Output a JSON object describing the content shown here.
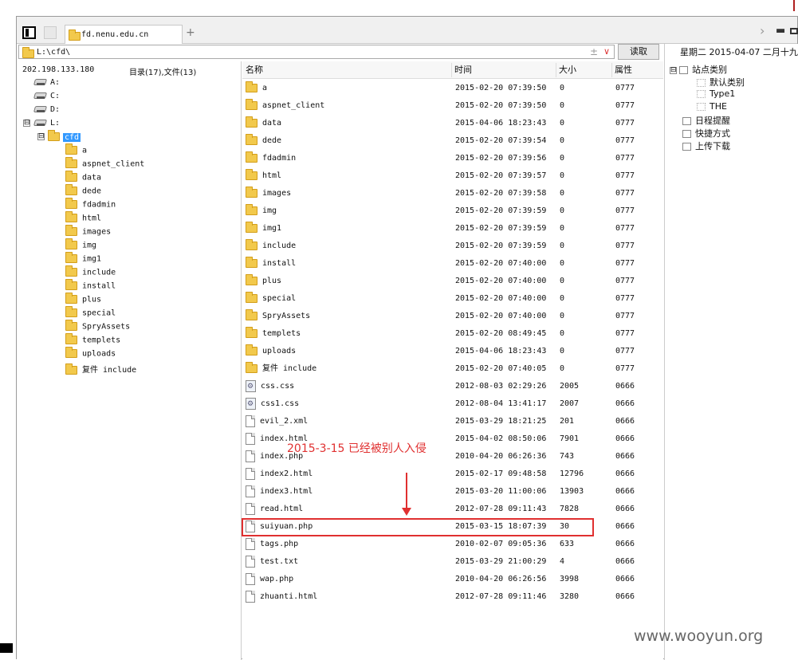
{
  "tab": {
    "title": "fd.nenu.edu.cn",
    "new_tab": "+"
  },
  "window": {
    "nav_arrow": "›",
    "minimize": "▬"
  },
  "address": {
    "path": "L:\\cfd\\",
    "plusminus": "±",
    "dropdown": "∨",
    "read_button": "读取"
  },
  "left": {
    "ip": "202.198.133.180",
    "dir_count": "目录(17),文件(13)",
    "drives": [
      {
        "label": "A:"
      },
      {
        "label": "C:"
      },
      {
        "label": "D:"
      },
      {
        "label": "L:",
        "expander": "⊟"
      }
    ],
    "cfd": {
      "label": "cfd",
      "expander": "⊟"
    },
    "folders": [
      "a",
      "aspnet_client",
      "data",
      "dede",
      "fdadmin",
      "html",
      "images",
      "img",
      "img1",
      "include",
      "install",
      "plus",
      "special",
      "SpryAssets",
      "templets",
      "uploads",
      "复件 include"
    ]
  },
  "files": {
    "columns": {
      "name": "名称",
      "time": "时间",
      "size": "大小",
      "attr": "属性"
    },
    "rows": [
      {
        "type": "folder",
        "name": "a",
        "time": "2015-02-20 07:39:50",
        "size": "0",
        "attr": "0777"
      },
      {
        "type": "folder",
        "name": "aspnet_client",
        "time": "2015-02-20 07:39:50",
        "size": "0",
        "attr": "0777"
      },
      {
        "type": "folder",
        "name": "data",
        "time": "2015-04-06 18:23:43",
        "size": "0",
        "attr": "0777"
      },
      {
        "type": "folder",
        "name": "dede",
        "time": "2015-02-20 07:39:54",
        "size": "0",
        "attr": "0777"
      },
      {
        "type": "folder",
        "name": "fdadmin",
        "time": "2015-02-20 07:39:56",
        "size": "0",
        "attr": "0777"
      },
      {
        "type": "folder",
        "name": "html",
        "time": "2015-02-20 07:39:57",
        "size": "0",
        "attr": "0777"
      },
      {
        "type": "folder",
        "name": "images",
        "time": "2015-02-20 07:39:58",
        "size": "0",
        "attr": "0777"
      },
      {
        "type": "folder",
        "name": "img",
        "time": "2015-02-20 07:39:59",
        "size": "0",
        "attr": "0777"
      },
      {
        "type": "folder",
        "name": "img1",
        "time": "2015-02-20 07:39:59",
        "size": "0",
        "attr": "0777"
      },
      {
        "type": "folder",
        "name": "include",
        "time": "2015-02-20 07:39:59",
        "size": "0",
        "attr": "0777"
      },
      {
        "type": "folder",
        "name": "install",
        "time": "2015-02-20 07:40:00",
        "size": "0",
        "attr": "0777"
      },
      {
        "type": "folder",
        "name": "plus",
        "time": "2015-02-20 07:40:00",
        "size": "0",
        "attr": "0777"
      },
      {
        "type": "folder",
        "name": "special",
        "time": "2015-02-20 07:40:00",
        "size": "0",
        "attr": "0777"
      },
      {
        "type": "folder",
        "name": "SpryAssets",
        "time": "2015-02-20 07:40:00",
        "size": "0",
        "attr": "0777"
      },
      {
        "type": "folder",
        "name": "templets",
        "time": "2015-02-20 08:49:45",
        "size": "0",
        "attr": "0777"
      },
      {
        "type": "folder",
        "name": "uploads",
        "time": "2015-04-06 18:23:43",
        "size": "0",
        "attr": "0777"
      },
      {
        "type": "folder",
        "name": "复件 include",
        "time": "2015-02-20 07:40:05",
        "size": "0",
        "attr": "0777"
      },
      {
        "type": "css",
        "name": "css.css",
        "time": "2012-08-03 02:29:26",
        "size": "2005",
        "attr": "0666"
      },
      {
        "type": "css",
        "name": "css1.css",
        "time": "2012-08-04 13:41:17",
        "size": "2007",
        "attr": "0666"
      },
      {
        "type": "file",
        "name": "evil_2.xml",
        "time": "2015-03-29 18:21:25",
        "size": "201",
        "attr": "0666"
      },
      {
        "type": "file",
        "name": "index.html",
        "time": "2015-04-02 08:50:06",
        "size": "7901",
        "attr": "0666"
      },
      {
        "type": "file",
        "name": "index.php",
        "time": "2010-04-20 06:26:36",
        "size": "743",
        "attr": "0666"
      },
      {
        "type": "file",
        "name": "index2.html",
        "time": "2015-02-17 09:48:58",
        "size": "12796",
        "attr": "0666"
      },
      {
        "type": "file",
        "name": "index3.html",
        "time": "2015-03-20 11:00:06",
        "size": "13903",
        "attr": "0666"
      },
      {
        "type": "file",
        "name": "read.html",
        "time": "2012-07-28 09:11:43",
        "size": "7828",
        "attr": "0666"
      },
      {
        "type": "file",
        "name": "suiyuan.php",
        "time": "2015-03-15 18:07:39",
        "size": "30",
        "attr": "0666"
      },
      {
        "type": "file",
        "name": "tags.php",
        "time": "2010-02-07 09:05:36",
        "size": "633",
        "attr": "0666"
      },
      {
        "type": "file",
        "name": "test.txt",
        "time": "2015-03-29 21:00:29",
        "size": "4",
        "attr": "0666"
      },
      {
        "type": "file",
        "name": "wap.php",
        "time": "2010-04-20 06:26:56",
        "size": "3998",
        "attr": "0666"
      },
      {
        "type": "file",
        "name": "zhuanti.html",
        "time": "2012-07-28 09:11:46",
        "size": "3280",
        "attr": "0666"
      }
    ]
  },
  "right": {
    "date_header": "星期二 2015-04-07 二月十九",
    "tree": [
      {
        "label": "站点类别",
        "indent": 0,
        "icon": "box",
        "exp": "⊟"
      },
      {
        "label": "默认类别",
        "indent": 1,
        "icon": "dot"
      },
      {
        "label": "Type1",
        "indent": 1,
        "icon": "dot"
      },
      {
        "label": "THE",
        "indent": 1,
        "icon": "dot"
      },
      {
        "label": "日程提醒",
        "indent": 0,
        "icon": "box"
      },
      {
        "label": "快捷方式",
        "indent": 0,
        "icon": "box"
      },
      {
        "label": "上传下载",
        "indent": 0,
        "icon": "box"
      }
    ]
  },
  "annotation": {
    "text": "2015-3-15   已经被别人入侵",
    "color": "#e03030"
  },
  "watermark": "www.wooyun.org",
  "colors": {
    "accent": "#3399ff",
    "folder": "#f2c94c",
    "highlight": "#e03030"
  }
}
